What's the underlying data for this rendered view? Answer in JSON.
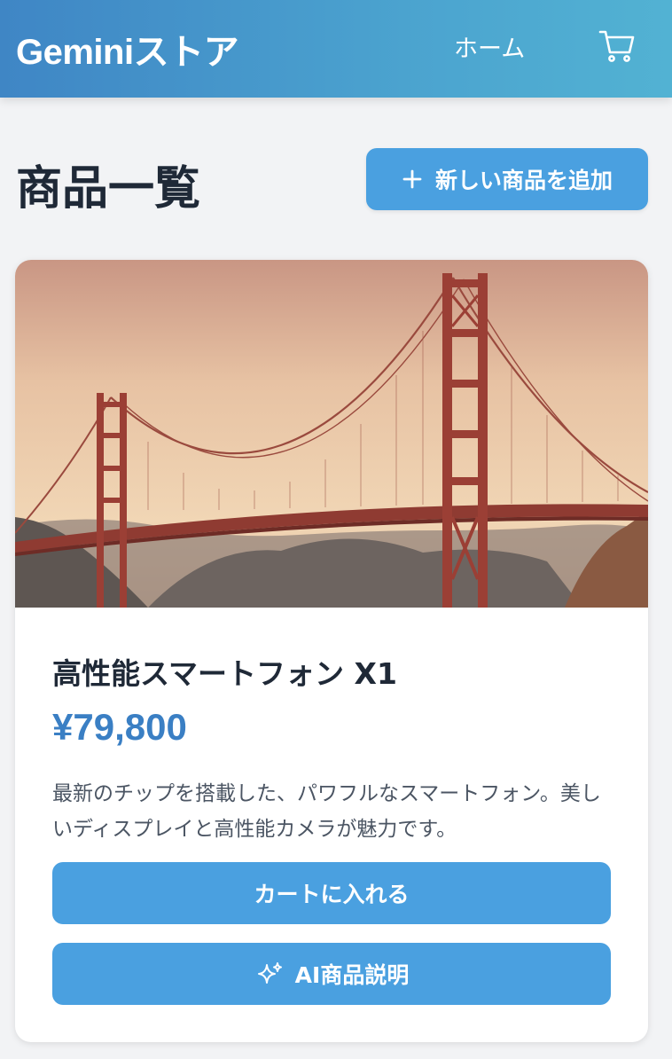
{
  "header": {
    "brand": "Geminiストア",
    "nav_home": "ホーム",
    "cart_icon": "shopping-cart-icon"
  },
  "page": {
    "title": "商品一覧",
    "add_button_label": "新しい商品を追加",
    "add_button_icon": "plus-icon"
  },
  "product": {
    "image": "golden-gate-bridge-photo",
    "name": "高性能スマートフォン X1",
    "price": "¥79,800",
    "description": "最新のチップを搭載した、パワフルなスマートフォン。美しいディスプレイと高性能カメラが魅力です。",
    "add_to_cart_label": "カートに入れる",
    "ai_description_label": "AI商品説明",
    "ai_icon": "sparkle-icon"
  },
  "colors": {
    "header_gradient_start": "#3f86c5",
    "header_gradient_end": "#52b2d3",
    "accent_button": "#4aa0e0",
    "price": "#3a7fc4",
    "background": "#f2f3f5"
  }
}
